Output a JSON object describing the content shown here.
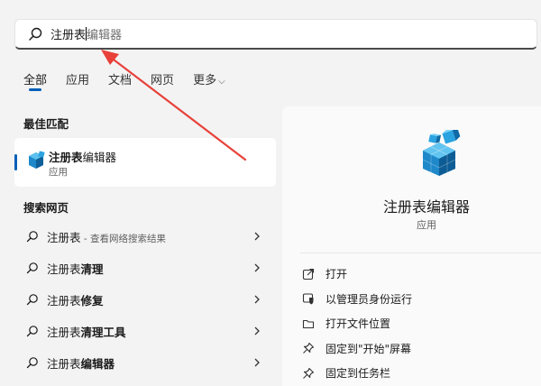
{
  "search": {
    "typed": "注册表",
    "hint": "编辑器"
  },
  "tabs": [
    {
      "label": "全部"
    },
    {
      "label": "应用"
    },
    {
      "label": "文档"
    },
    {
      "label": "网页"
    },
    {
      "label": "更多"
    }
  ],
  "best_match": {
    "section_title": "最佳匹配",
    "name_typed": "注册表",
    "name_rest": "编辑器",
    "type": "应用"
  },
  "web": {
    "section_title": "搜索网页",
    "items": [
      {
        "typed": "注册表",
        "rest": "",
        "extra": " - 查看网络搜索结果"
      },
      {
        "typed": "注册表",
        "rest": "清理",
        "extra": ""
      },
      {
        "typed": "注册表",
        "rest": "修复",
        "extra": ""
      },
      {
        "typed": "注册表",
        "rest": "清理工具",
        "extra": ""
      },
      {
        "typed": "注册表",
        "rest": "编辑器",
        "extra": ""
      }
    ]
  },
  "detail": {
    "title": "注册表编辑器",
    "subtitle": "应用",
    "actions": [
      {
        "label": "打开",
        "icon": "open-icon"
      },
      {
        "label": "以管理员身份运行",
        "icon": "shield-icon"
      },
      {
        "label": "打开文件位置",
        "icon": "folder-icon"
      },
      {
        "label": "固定到\"开始\"屏幕",
        "icon": "pin-icon"
      },
      {
        "label": "固定到任务栏",
        "icon": "pin-icon"
      }
    ]
  },
  "colors": {
    "accent": "#005fb8",
    "arrow": "#e8413a"
  }
}
